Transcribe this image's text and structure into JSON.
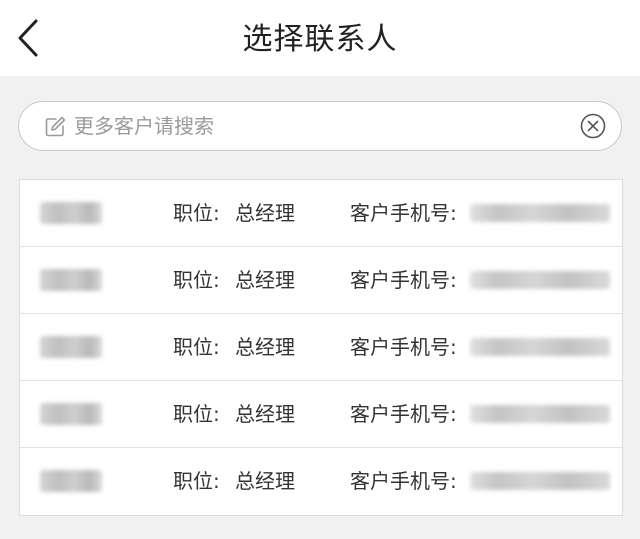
{
  "header": {
    "title": "选择联系人",
    "back_icon": "chevron-left-icon"
  },
  "search": {
    "value": "",
    "placeholder": "更多客户请搜索",
    "leading_icon": "edit-icon",
    "clear_icon": "clear-circle-icon"
  },
  "contacts": [
    {
      "position_label": "职位:",
      "position": "总经理",
      "phone_label": "客户手机号:"
    },
    {
      "position_label": "职位:",
      "position": "总经理",
      "phone_label": "客户手机号:"
    },
    {
      "position_label": "职位:",
      "position": "总经理",
      "phone_label": "客户手机号:"
    },
    {
      "position_label": "职位:",
      "position": "总经理",
      "phone_label": "客户手机号:"
    },
    {
      "position_label": "职位:",
      "position": "总经理",
      "phone_label": "客户手机号:"
    }
  ],
  "colors": {
    "page_background": "#f1f1f1",
    "card_background": "#ffffff",
    "text_primary": "#333333",
    "placeholder": "#9a9a9a",
    "border": "#dcdcdc"
  }
}
